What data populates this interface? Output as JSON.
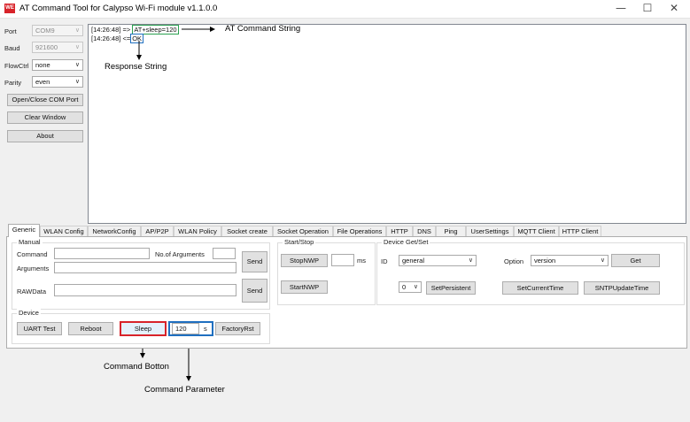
{
  "window": {
    "title": "AT Command Tool for Calypso Wi-Fi module  v1.1.0.0",
    "logo_text": "WE",
    "minimize_glyph": "—",
    "maximize_glyph": "☐",
    "close_glyph": "✕"
  },
  "serial": {
    "port_label": "Port",
    "port_value": "COM9",
    "baud_label": "Baud",
    "baud_value": "921600",
    "flowctrl_label": "FlowCtrl",
    "flowctrl_value": "none",
    "parity_label": "Parity",
    "parity_value": "even",
    "open_close_label": "Open/Close COM Port",
    "clear_label": "Clear Window",
    "about_label": "About"
  },
  "log": {
    "line1_prefix": "[14:26:48] =>",
    "line1_cmd": "AT+sleep=120",
    "line2_prefix": "[14:26:48] <=",
    "line2_resp": "OK"
  },
  "annotations": {
    "at_command_string": "AT Command String",
    "response_string": "Response String",
    "command_button": "Command Botton",
    "command_parameter": "Command Parameter"
  },
  "tabs": [
    "Generic",
    "WLAN Config",
    "NetworkConfig",
    "AP/P2P",
    "WLAN Policy",
    "Socket create",
    "Socket Operation",
    "File Operations",
    "HTTP",
    "DNS",
    "Ping",
    "UserSettings",
    "MQTT Client",
    "HTTP Client"
  ],
  "manual": {
    "group_title": "Manual",
    "command_label": "Command",
    "num_args_label": "No.of Arguments",
    "arguments_label": "Arguments",
    "rawdata_label": "RAWData",
    "send1_label": "Send",
    "send2_label": "Send"
  },
  "device": {
    "group_title": "Device",
    "uart_test_label": "UART Test",
    "reboot_label": "Reboot",
    "sleep_label": "Sleep",
    "sleep_param_value": "120",
    "sleep_unit": "s",
    "factory_rst_label": "FactoryRst"
  },
  "startstop": {
    "group_title": "Start/Stop",
    "stop_label": "StopNWP",
    "ms_unit": "ms",
    "start_label": "StartNWP"
  },
  "devget": {
    "group_title": "Device Get/Set",
    "id_label": "ID",
    "id_value": "general",
    "option_label": "Option",
    "option_value": "version",
    "get_label": "Get",
    "persist_value": "0",
    "set_persistent_label": "SetPersistent",
    "set_time_label": "SetCurrentTime",
    "sntp_label": "SNTPUpdateTime"
  },
  "colors": {
    "green_highlight": "#2aa050",
    "blue_highlight": "#1f6fc0",
    "red_highlight": "#d8232a",
    "brand_red": "#d8232a"
  }
}
